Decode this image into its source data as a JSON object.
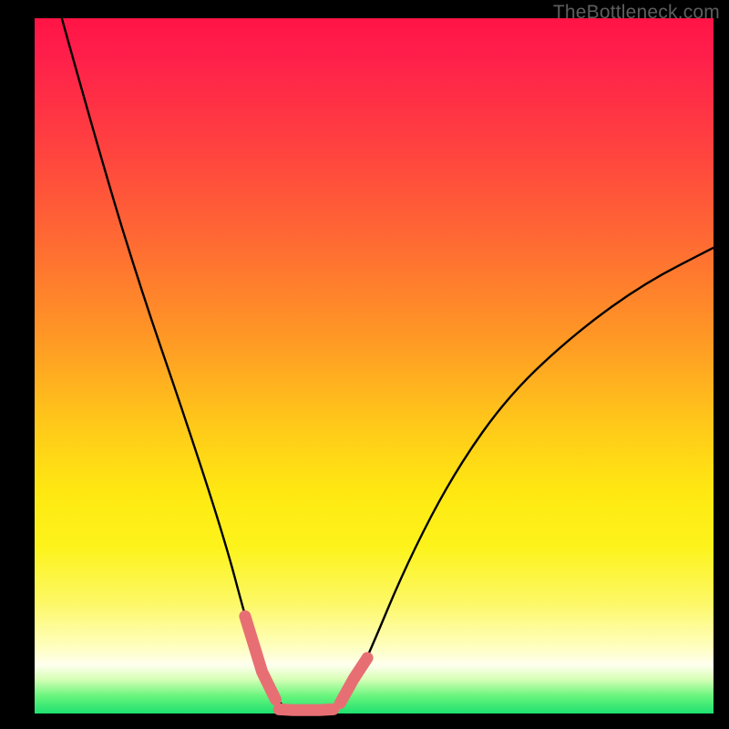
{
  "watermark": "TheBottleneck.com",
  "chart_data": {
    "type": "line",
    "title": "",
    "xlabel": "",
    "ylabel": "",
    "xlim": [
      0,
      100
    ],
    "ylim": [
      0,
      100
    ],
    "series": [
      {
        "name": "bottleneck-curve",
        "x": [
          4,
          10,
          16,
          22,
          28,
          31,
          33.5,
          35.5,
          37.5,
          40,
          44,
          46,
          49,
          55,
          62,
          70,
          80,
          90,
          100
        ],
        "y": [
          100,
          79,
          60,
          43,
          25,
          14,
          6,
          2,
          0.5,
          0.5,
          0.5,
          2,
          8,
          22,
          35,
          46,
          55,
          62,
          67
        ]
      }
    ],
    "highlight_segments": [
      {
        "name": "v-left",
        "x": [
          31,
          33.5,
          35.5
        ],
        "y": [
          14,
          6,
          2
        ]
      },
      {
        "name": "v-bottom",
        "x": [
          36,
          38,
          40,
          42,
          44
        ],
        "y": [
          0.6,
          0.5,
          0.5,
          0.5,
          0.6
        ]
      },
      {
        "name": "v-right",
        "x": [
          45,
          47,
          49
        ],
        "y": [
          1.5,
          5,
          8
        ]
      }
    ],
    "colors": {
      "curve": "#000000",
      "highlight": "#e76f74"
    }
  }
}
